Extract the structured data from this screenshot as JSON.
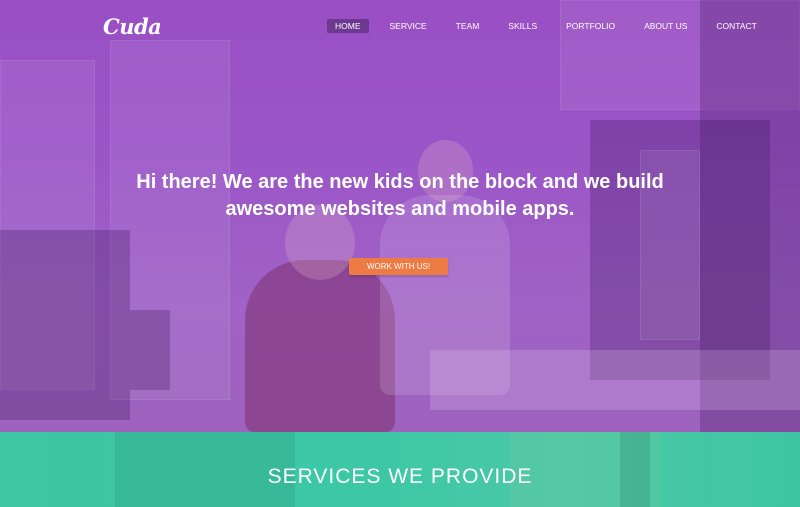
{
  "nav": {
    "logo": "Cuda",
    "items": [
      {
        "label": "HOME",
        "active": true
      },
      {
        "label": "SERVICE",
        "active": false
      },
      {
        "label": "TEAM",
        "active": false
      },
      {
        "label": "SKILLS",
        "active": false
      },
      {
        "label": "PORTFOLIO",
        "active": false
      },
      {
        "label": "ABOUT US",
        "active": false
      },
      {
        "label": "CONTACT",
        "active": false
      }
    ]
  },
  "hero": {
    "headline_line1": "Hi there! We are the new kids on the block and we build",
    "headline_line2": "awesome websites and mobile apps.",
    "cta_label": "WORK WITH US!"
  },
  "services": {
    "title": "SERVICES WE PROVIDE"
  },
  "colors": {
    "hero_overlay": "#9a55c7",
    "cta": "#ee7b43",
    "services_bg": "#3fc6a4",
    "active_nav": "#5a2a7a"
  }
}
